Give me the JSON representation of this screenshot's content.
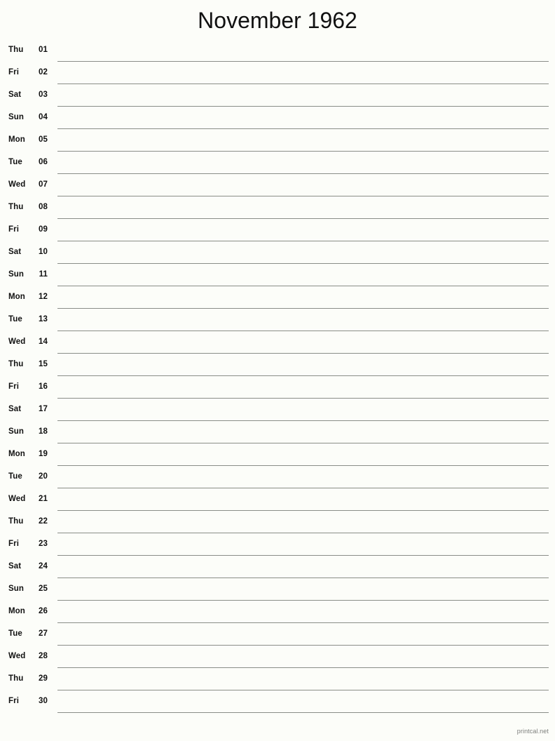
{
  "header": {
    "title": "November 1962",
    "month_name": "November",
    "year": "1962"
  },
  "calendar": {
    "days": [
      {
        "weekday": "Thu",
        "date": "01"
      },
      {
        "weekday": "Fri",
        "date": "02"
      },
      {
        "weekday": "Sat",
        "date": "03"
      },
      {
        "weekday": "Sun",
        "date": "04"
      },
      {
        "weekday": "Mon",
        "date": "05"
      },
      {
        "weekday": "Tue",
        "date": "06"
      },
      {
        "weekday": "Wed",
        "date": "07"
      },
      {
        "weekday": "Thu",
        "date": "08"
      },
      {
        "weekday": "Fri",
        "date": "09"
      },
      {
        "weekday": "Sat",
        "date": "10"
      },
      {
        "weekday": "Sun",
        "date": "11"
      },
      {
        "weekday": "Mon",
        "date": "12"
      },
      {
        "weekday": "Tue",
        "date": "13"
      },
      {
        "weekday": "Wed",
        "date": "14"
      },
      {
        "weekday": "Thu",
        "date": "15"
      },
      {
        "weekday": "Fri",
        "date": "16"
      },
      {
        "weekday": "Sat",
        "date": "17"
      },
      {
        "weekday": "Sun",
        "date": "18"
      },
      {
        "weekday": "Mon",
        "date": "19"
      },
      {
        "weekday": "Tue",
        "date": "20"
      },
      {
        "weekday": "Wed",
        "date": "21"
      },
      {
        "weekday": "Thu",
        "date": "22"
      },
      {
        "weekday": "Fri",
        "date": "23"
      },
      {
        "weekday": "Sat",
        "date": "24"
      },
      {
        "weekday": "Sun",
        "date": "25"
      },
      {
        "weekday": "Mon",
        "date": "26"
      },
      {
        "weekday": "Tue",
        "date": "27"
      },
      {
        "weekday": "Wed",
        "date": "28"
      },
      {
        "weekday": "Thu",
        "date": "29"
      },
      {
        "weekday": "Fri",
        "date": "30"
      }
    ]
  },
  "footer": {
    "attribution": "printcal.net"
  },
  "colors": {
    "background": "#fcfdf9",
    "text": "#111111",
    "rule_line": "#8a8d88",
    "footer_text": "#7d7f7c"
  }
}
